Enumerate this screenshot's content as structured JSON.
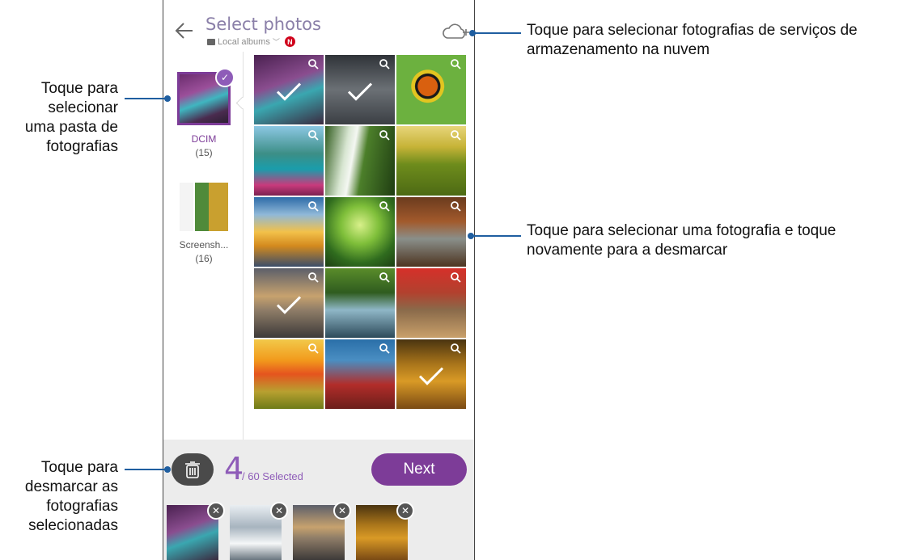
{
  "header": {
    "title": "Select photos",
    "subtitle": "Local albums",
    "badge": "N"
  },
  "folders": [
    {
      "name": "DCIM",
      "count": "(15)",
      "selected": true
    },
    {
      "name": "Screensh...",
      "count": "(16)",
      "selected": false
    }
  ],
  "grid": {
    "tiles": [
      {
        "selected": true
      },
      {
        "selected": true
      },
      {
        "selected": false
      },
      {
        "selected": false
      },
      {
        "selected": false
      },
      {
        "selected": false
      },
      {
        "selected": false
      },
      {
        "selected": false
      },
      {
        "selected": false
      },
      {
        "selected": true
      },
      {
        "selected": false
      },
      {
        "selected": false
      },
      {
        "selected": false
      },
      {
        "selected": false
      },
      {
        "selected": true
      }
    ]
  },
  "bottom_bar": {
    "selected_count": "4",
    "selected_suffix": "/ 60 Selected",
    "next_label": "Next"
  },
  "callouts": {
    "cloud": "Toque para selecionar fotografias de serviços de armazenamento na nuvem",
    "folder_line1": "Toque para",
    "folder_line2": "selecionar",
    "folder_line3": "uma pasta de",
    "folder_line4": "fotografias",
    "photo_line1": "Toque para selecionar uma fotografia e toque",
    "photo_line2": "novamente para a desmarcar",
    "deselect_line1": "Toque para",
    "deselect_line2": "desmarcar as",
    "deselect_line3": "fotografias",
    "deselect_line4": "selecionadas"
  },
  "colors": {
    "accent": "#7d3c98",
    "callout_line": "#1f5ea0",
    "badge": "#d0021b"
  }
}
